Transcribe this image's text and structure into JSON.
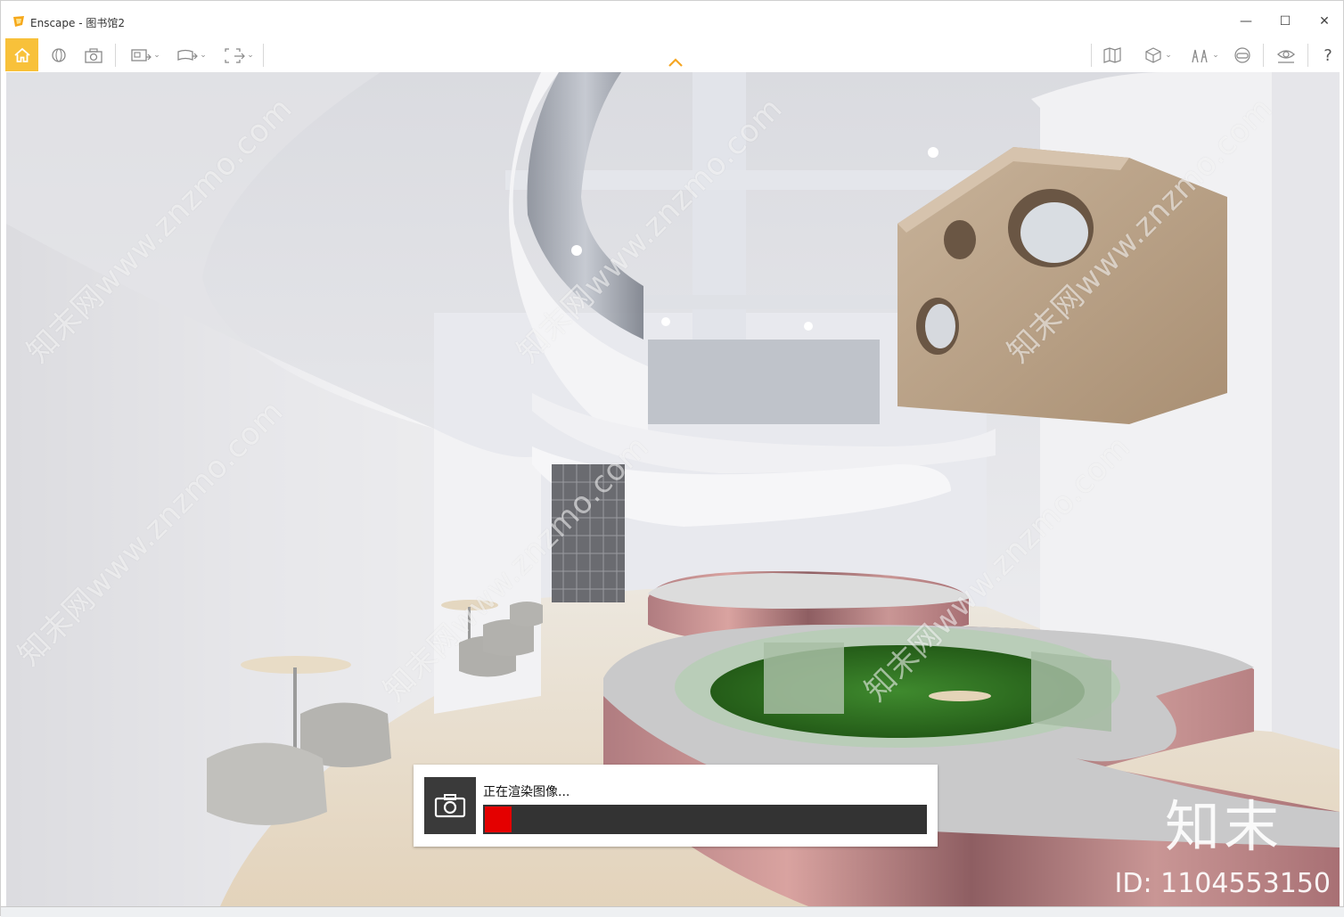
{
  "window": {
    "app_name": "Enscape",
    "separator": " - ",
    "document_name": "图书馆2",
    "minimize_glyph": "—",
    "maximize_glyph": "☐",
    "close_glyph": "✕"
  },
  "toolbar": {
    "left_buttons": [
      "home-icon",
      "orbit-icon",
      "screenshot-icon",
      "batch-render-icon",
      "panorama-icon",
      "export-icon"
    ],
    "right_buttons": [
      "map-icon",
      "cube-view-icon",
      "asset-library-icon",
      "vr-headset-icon",
      "visual-settings-icon",
      "help-icon"
    ],
    "help_label": "?",
    "accent_color": "#f8c13a"
  },
  "viewport": {
    "watermark_text": "知末网www.znzmo.com",
    "brand_text": "知末",
    "id_text": "ID: 1104553150"
  },
  "render_dialog": {
    "label": "正在渲染图像...",
    "progress_fraction": 0.06,
    "progress_color": "#e40000",
    "icon": "camera-icon"
  }
}
